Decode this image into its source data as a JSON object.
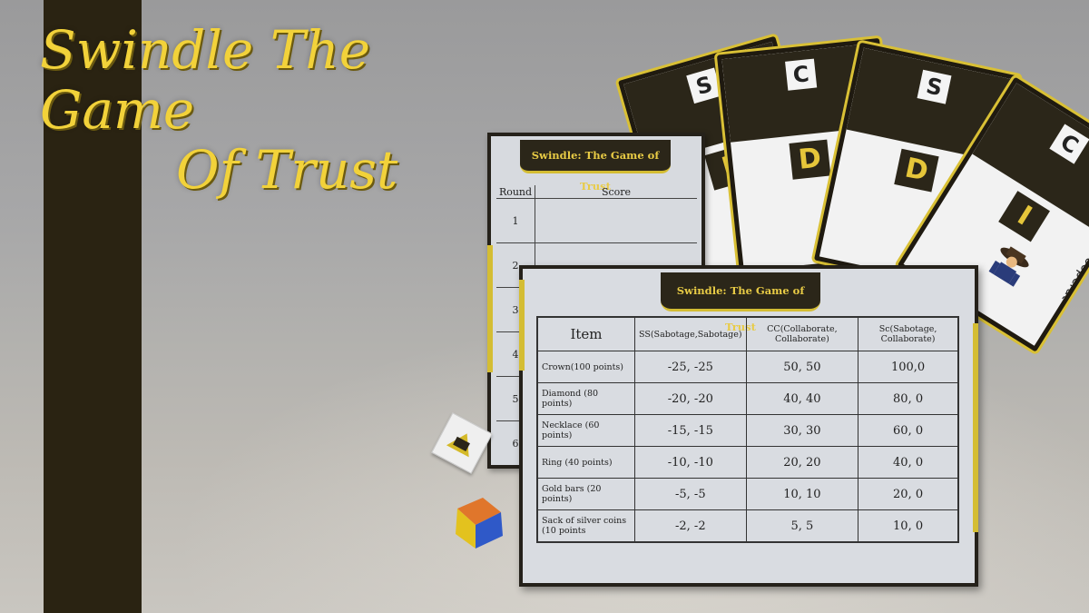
{
  "game": {
    "title_line1": "Swindle The Game",
    "title_line2": "Of Trust"
  },
  "cards": [
    {
      "top_letter": "S",
      "big_letter": "I"
    },
    {
      "top_letter": "C",
      "big_letter": "D"
    },
    {
      "top_letter": "S",
      "big_letter": "D"
    },
    {
      "top_letter": "C",
      "big_letter": "I",
      "caption": "Cooperat"
    }
  ],
  "score_sheet": {
    "header": "Swindle: The Game of Trust",
    "col_round": "Round",
    "col_score": "Score",
    "rounds": [
      "1",
      "2",
      "3",
      "4",
      "5",
      "6"
    ]
  },
  "payoff_sheet": {
    "header": "Swindle: The Game of Trust",
    "columns": [
      "Item",
      "SS(Sabotage,Sabotage)",
      "CC(Collaborate, Collaborate)",
      "Sc(Sabotage, Collaborate)"
    ],
    "rows": [
      {
        "item": "Crown(100 points)",
        "ss": "-25, -25",
        "cc": "50, 50",
        "sc": "100,0"
      },
      {
        "item": "Diamond (80 points)",
        "ss": "-20, -20",
        "cc": "40, 40",
        "sc": "80, 0"
      },
      {
        "item": "Necklace (60 points)",
        "ss": "-15, -15",
        "cc": "30, 30",
        "sc": "60, 0"
      },
      {
        "item": "Ring (40 points)",
        "ss": "-10, -10",
        "cc": "20, 20",
        "sc": "40, 0"
      },
      {
        "item": "Gold bars (20 points)",
        "ss": "-5, -5",
        "cc": "10, 10",
        "sc": "20, 0"
      },
      {
        "item": "Sack of silver coins (10 points",
        "ss": "-2, -2",
        "cc": "5, 5",
        "sc": "10, 0"
      }
    ]
  },
  "colors": {
    "accent_yellow": "#f2d23a",
    "dark_brown": "#2a2312",
    "die_blue": "#2f59c8",
    "die_orange": "#e0762b",
    "die_yellow": "#e3c21e"
  }
}
